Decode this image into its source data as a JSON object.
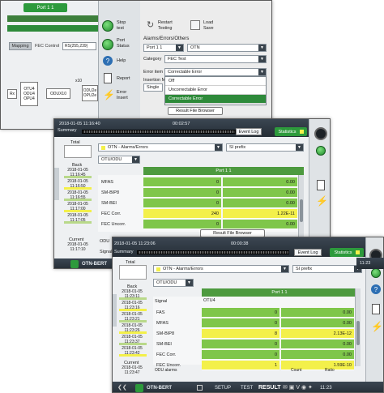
{
  "win1": {
    "port_tab": "Port 1 1",
    "mapping_label": "Mapping",
    "fec_control_label": "FEC Control",
    "fec_control_value": "RS(255,239)",
    "rx_label": "Rx",
    "otu_block": "OTU4\nODU4\nOPU4",
    "odux_block": "ODUX10",
    "x10_label": "x10",
    "odu2e_block": "ODU2e\nOPU2e",
    "stop_test": "Stop\ntest",
    "port_status": "Port\nStatus",
    "help": "Help",
    "report": "Report",
    "error_insert": "Error\nInsert",
    "restart_testing": "Restart\nTesting",
    "load_save": "Load\nSave",
    "alarms_errors_others": "Alarms/Errors/Others",
    "port_select": "Port 1 1",
    "layer_select": "OTN",
    "category_label": "Category",
    "category_value": "FEC Test",
    "error_item_label": "Error item",
    "error_item_value": "Correctable Error",
    "insertion_mode_label": "Insertion M",
    "single_value": "Single",
    "dropdown_options": [
      "Off",
      "Uncorrectable Error",
      "Correctable Error"
    ],
    "result_file_browser": "Result File Browser"
  },
  "win2": {
    "datetime": "2018-01-05 11:16:40",
    "elapsed": "00:02:57",
    "summary_tab": "Summary",
    "event_log": "Event Log",
    "statistics": "Statistics",
    "total_label": "Total",
    "category_select": "OTN - Alarms/Errors",
    "prefix_select": "SI prefix",
    "level_select": "OTU/ODU",
    "back_label": "Back",
    "current_label": "Current",
    "timestamps": [
      "2018-01-05\n11:16:45",
      "2018-01-05\n11:16:50",
      "2018-01-05\n11:16:55",
      "2018-01-05\n11:17:00",
      "2018-01-05\n11:17:05"
    ],
    "current_timestamp": "2018-01-05\n11:17:10",
    "port_header": "Port 1 1",
    "rows": [
      {
        "label": "MFAS",
        "count": "0",
        "rate": "0.00"
      },
      {
        "label": "SM-BIP8",
        "count": "0",
        "rate": "0.00"
      },
      {
        "label": "SM-BEI",
        "count": "0",
        "rate": "0.00"
      },
      {
        "label": "FEC Corr.",
        "count": "240",
        "rate": "1.22E-11"
      },
      {
        "label": "FEC Uncorr.",
        "count": "0",
        "rate": "0.00"
      }
    ],
    "odu_label": "ODU",
    "signal_label": "Signal",
    "app_name": "OTN-BERT",
    "result_file_browser": "Result File Browser"
  },
  "win3": {
    "datetime": "2018-01-05 11:23:06",
    "elapsed": "00:00:38",
    "summary_tab": "Summary",
    "event_log": "Event Log",
    "statistics": "Statistics",
    "total_label": "Total",
    "category_select": "OTN - Alarms/Errors",
    "prefix_select": "SI prefix",
    "level_select": "OTU/ODU",
    "back_label": "Back",
    "current_label": "Current",
    "timestamps": [
      "2018-01-05\n11:23:11",
      "2018-01-05\n11:23:16",
      "2018-01-05\n11:23:21",
      "2018-01-05\n11:23:26",
      "2018-01-05\n11:23:37",
      "2018-01-05\n11:23:42"
    ],
    "current_timestamp": "2018-01-05\n11:23:47",
    "port_header": "Port 1 1",
    "signal_label": "Signal",
    "signal_value": "OTU4",
    "rows": [
      {
        "label": "FAS",
        "count": "0",
        "rate": "0.00"
      },
      {
        "label": "MFAS",
        "count": "0",
        "rate": "0.00"
      },
      {
        "label": "SM-BIP8",
        "count": "8",
        "rate": "2.13E-12"
      },
      {
        "label": "SM-BEI",
        "count": "0",
        "rate": "0.00"
      },
      {
        "label": "FEC Corr.",
        "count": "0",
        "rate": "0.00"
      },
      {
        "label": "FEC Uncorr.",
        "count": "1",
        "rate": "1.59E-10"
      }
    ],
    "odu_alarms_label": "ODU alarms",
    "count_label": "Count",
    "ratio_label": "Ratio",
    "app_name": "OTN-BERT",
    "setup": "SETUP",
    "test": "TEST",
    "result": "RESULT",
    "time": "11:23"
  },
  "right_edge": {
    "time": "11:23"
  },
  "colors": {
    "green": "#7fc64a",
    "yellow": "#f3f04a",
    "header_green": "#4d9a3f",
    "dark": "#2c343c"
  }
}
